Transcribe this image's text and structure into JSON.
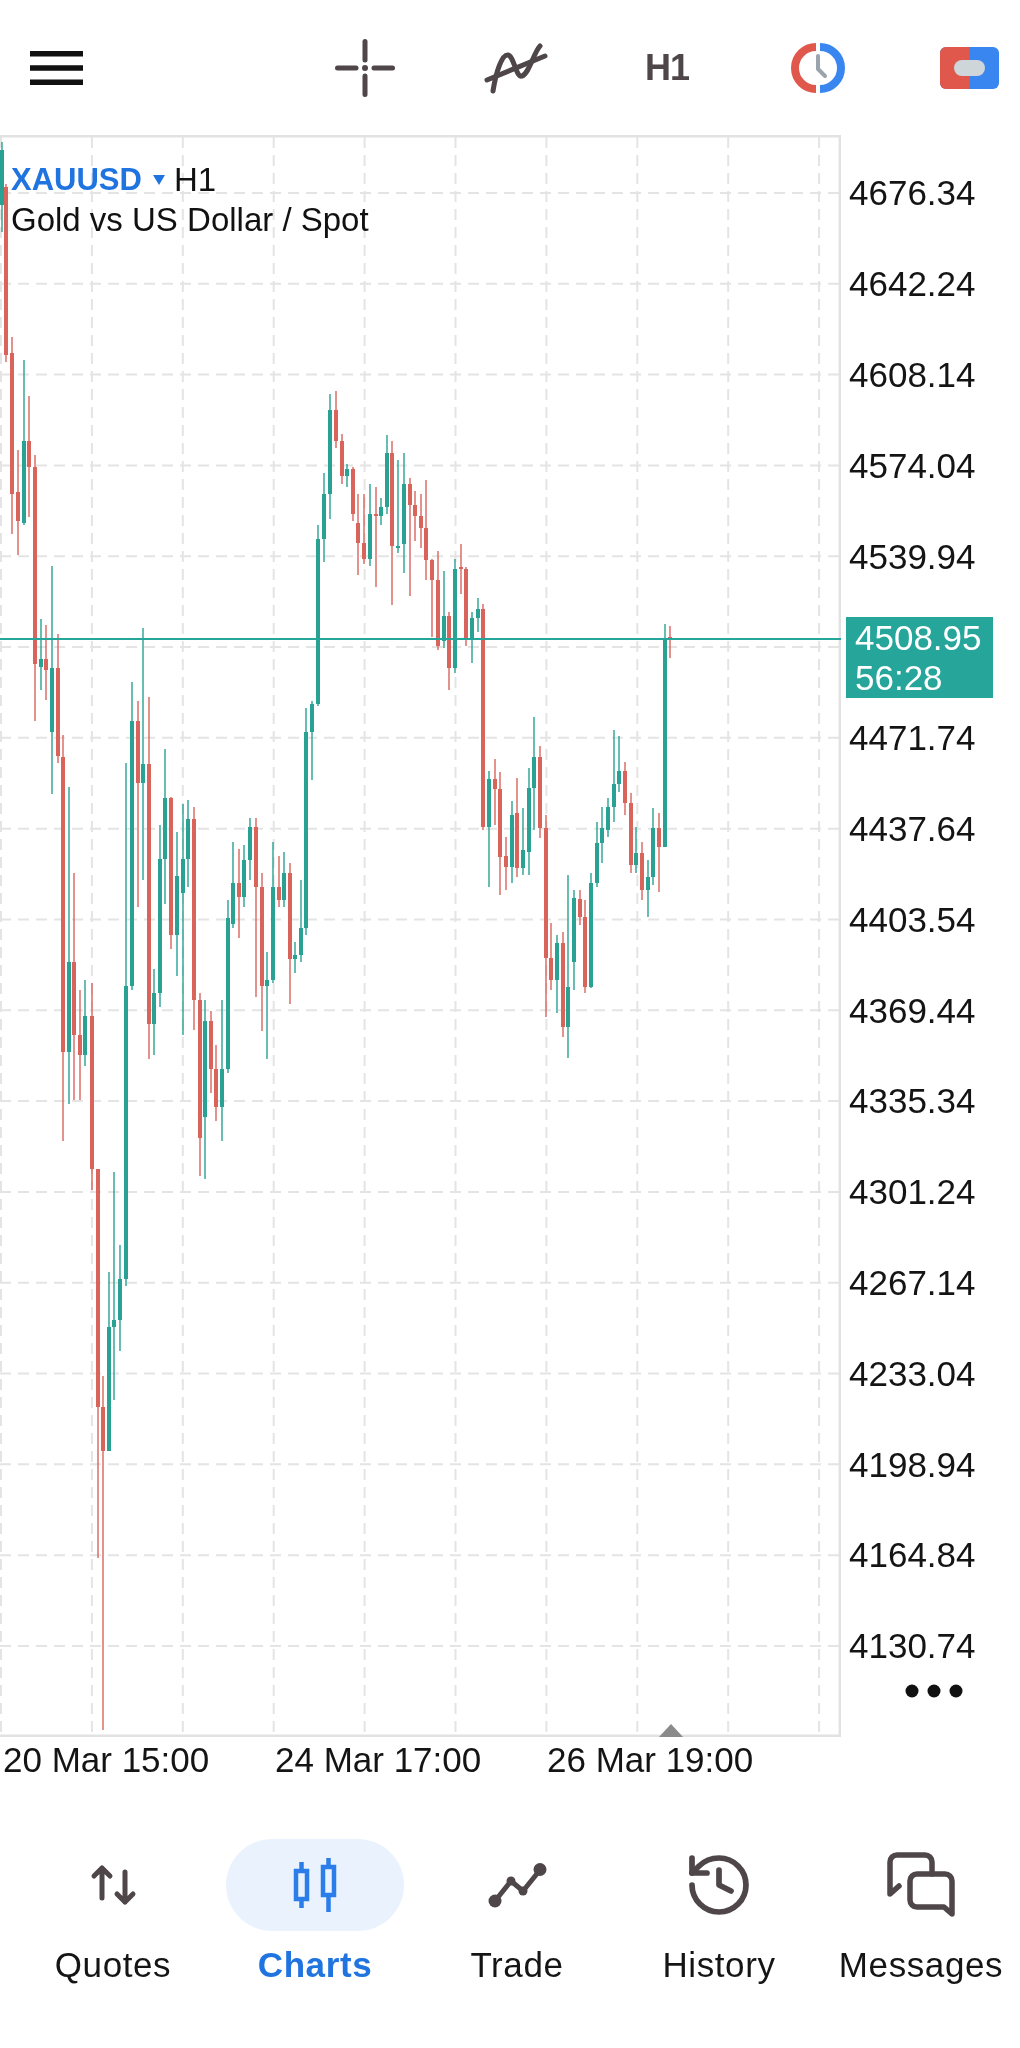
{
  "toolbar": {
    "timeframe": "H1"
  },
  "chart": {
    "symbol": "XAUUSD",
    "period": "H1",
    "description": "Gold vs US Dollar / Spot",
    "price_axis": [
      {
        "kind": "label",
        "text": "4676.34"
      },
      {
        "kind": "label",
        "text": "4642.24"
      },
      {
        "kind": "label",
        "text": "4608.14"
      },
      {
        "kind": "label",
        "text": "4574.04"
      },
      {
        "kind": "label",
        "text": "4539.94"
      },
      {
        "kind": "current",
        "price": "4508.95",
        "countdown": "56:28"
      },
      {
        "kind": "label",
        "text": "4471.74"
      },
      {
        "kind": "label",
        "text": "4437.64"
      },
      {
        "kind": "label",
        "text": "4403.54"
      },
      {
        "kind": "label",
        "text": "4369.44"
      },
      {
        "kind": "label",
        "text": "4335.34"
      },
      {
        "kind": "label",
        "text": "4301.24"
      },
      {
        "kind": "label",
        "text": "4267.14"
      },
      {
        "kind": "label",
        "text": "4233.04"
      },
      {
        "kind": "label",
        "text": "4198.94"
      },
      {
        "kind": "label",
        "text": "4164.84"
      },
      {
        "kind": "label",
        "text": "4130.74"
      }
    ],
    "time_axis": [
      "20 Mar 15:00",
      "24 Mar 17:00",
      "26 Mar 19:00"
    ]
  },
  "nav": [
    {
      "label": "Quotes",
      "selected": false
    },
    {
      "label": "Charts",
      "selected": true
    },
    {
      "label": "Trade",
      "selected": false
    },
    {
      "label": "History",
      "selected": false
    },
    {
      "label": "Messages",
      "selected": false
    }
  ]
}
